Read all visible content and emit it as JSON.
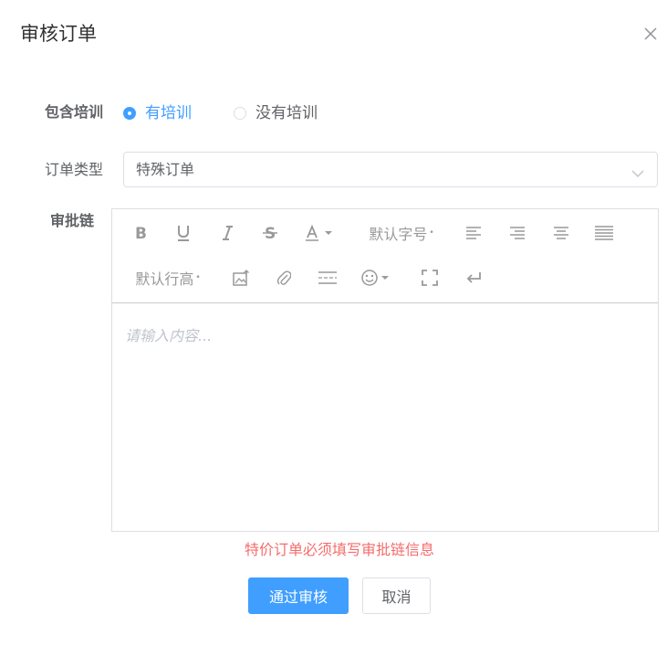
{
  "dialog": {
    "title": "审核订单"
  },
  "form": {
    "training_label": "包含培训",
    "training_options": [
      {
        "label": "有培训",
        "checked": true
      },
      {
        "label": "没有培训",
        "checked": false
      }
    ],
    "order_type_label": "订单类型",
    "order_type_value": "特殊订单",
    "approval_label": "审批链",
    "editor": {
      "font_size_label": "默认字号",
      "line_height_label": "默认行高",
      "placeholder": "请输入内容..."
    },
    "error_message": "特价订单必须填写审批链信息"
  },
  "buttons": {
    "approve": "通过审核",
    "cancel": "取消"
  },
  "colors": {
    "primary": "#409eff",
    "error": "#f56c6c",
    "border": "#dcdfe6"
  }
}
